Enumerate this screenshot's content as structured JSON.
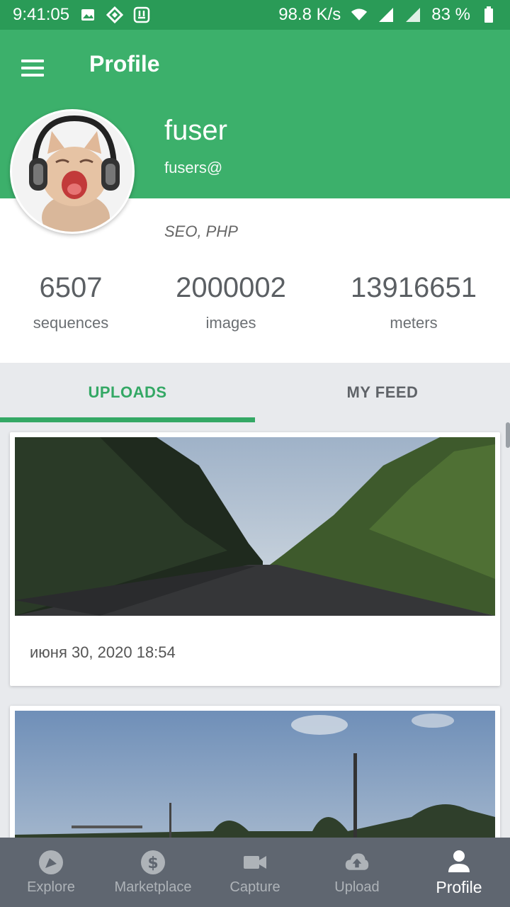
{
  "status_bar": {
    "time": "9:41:05",
    "speed": "98.8 K/s",
    "battery": "83 %",
    "icons": [
      "image-icon",
      "diamond-icon",
      "download-icon",
      "wifi-icon",
      "signal-icon",
      "signal-icon",
      "battery-icon"
    ]
  },
  "appbar": {
    "title": "Profile",
    "menu_icon": "hamburger-menu-icon"
  },
  "profile": {
    "name": "fuser",
    "email": "fusers@",
    "tags": "SEO, PHP",
    "avatar": "cat-with-headphones-avatar"
  },
  "stats": [
    {
      "value": "6507",
      "label": "sequences"
    },
    {
      "value": "2000002",
      "label": "images"
    },
    {
      "value": "13916651",
      "label": "meters"
    }
  ],
  "tabs": [
    {
      "label": "UPLOADS",
      "active": true
    },
    {
      "label": "MY FEED",
      "active": false
    }
  ],
  "uploads": [
    {
      "date": "июня 30, 2020 18:54",
      "image": "road-between-trees-photo"
    },
    {
      "image": "sky-with-poles-photo"
    }
  ],
  "bottom_nav": [
    {
      "label": "Explore",
      "icon": "compass-icon"
    },
    {
      "label": "Marketplace",
      "icon": "dollar-icon"
    },
    {
      "label": "Capture",
      "icon": "video-camera-icon"
    },
    {
      "label": "Upload",
      "icon": "cloud-upload-icon"
    },
    {
      "label": "Profile",
      "icon": "person-icon",
      "active": true
    }
  ],
  "colors": {
    "primary": "#3cb06b",
    "status_bar": "#2a9b57",
    "accent": "#34a865",
    "bottom_nav": "#5f6670"
  }
}
